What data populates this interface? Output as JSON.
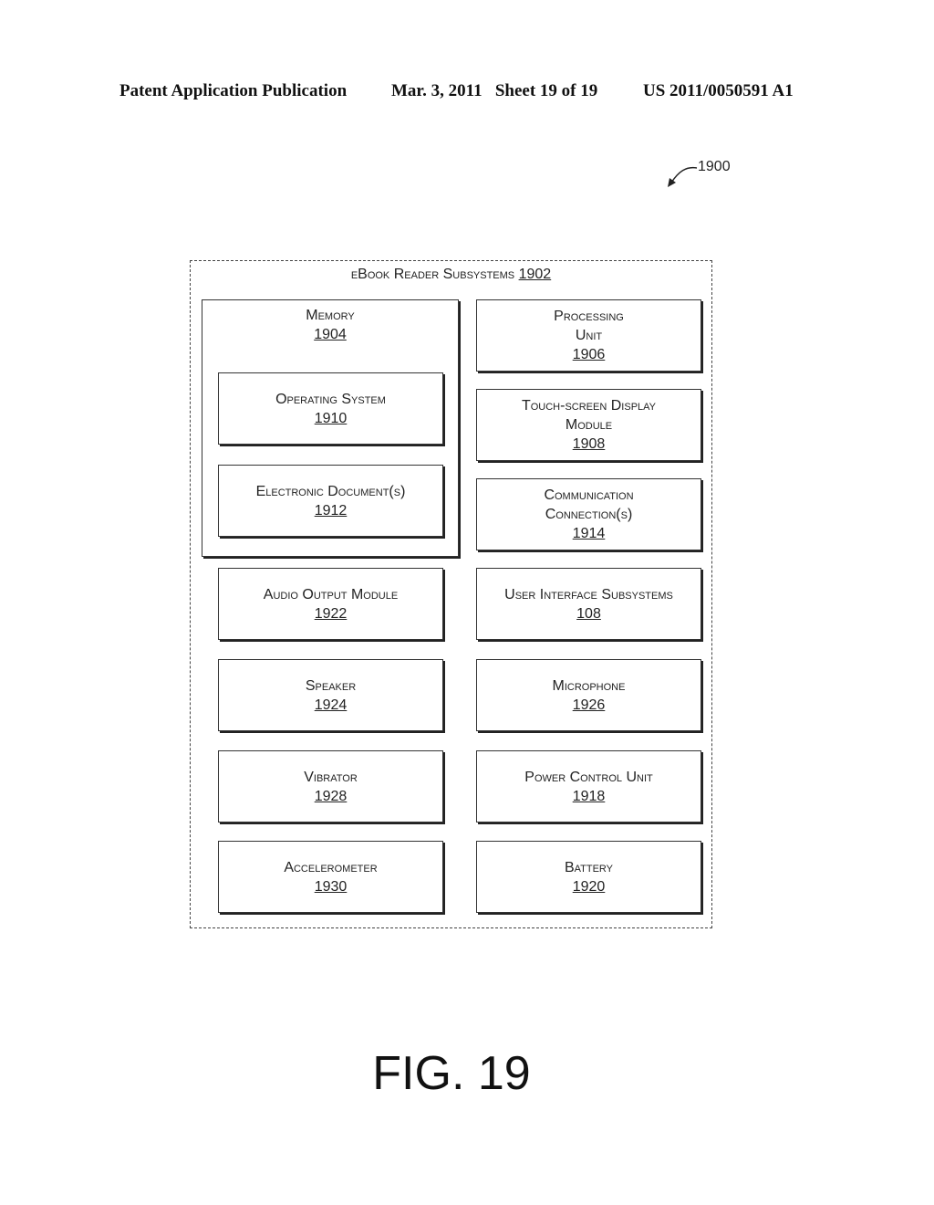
{
  "header": {
    "publication": "Patent Application Publication",
    "date_sheet": "Mar. 3, 2011   Sheet 19 of 19",
    "patent_number": "US 2011/0050591 A1"
  },
  "figure_ref": "1900",
  "subsystems": {
    "title": "eBook Reader Subsystems",
    "number": "1902"
  },
  "memory": {
    "label": "Memory",
    "number": "1904",
    "children": [
      {
        "label": "Operating System",
        "number": "1910"
      },
      {
        "label": "Electronic Document(s)",
        "number": "1912"
      }
    ]
  },
  "left_column": [
    {
      "label": "Audio Output Module",
      "number": "1922"
    },
    {
      "label": "Speaker",
      "number": "1924"
    },
    {
      "label": "Vibrator",
      "number": "1928"
    },
    {
      "label": "Accelerometer",
      "number": "1930"
    }
  ],
  "right_column": [
    {
      "label": "Processing\nUnit",
      "number": "1906"
    },
    {
      "label": "Touch-screen Display\nModule",
      "number": "1908"
    },
    {
      "label": "Communication\nConnection(s)",
      "number": "1914"
    },
    {
      "label": "User Interface Subsystems",
      "number": "108"
    },
    {
      "label": "Microphone",
      "number": "1926"
    },
    {
      "label": "Power Control Unit",
      "number": "1918"
    },
    {
      "label": "Battery",
      "number": "1920"
    }
  ],
  "caption": "FIG. 19"
}
